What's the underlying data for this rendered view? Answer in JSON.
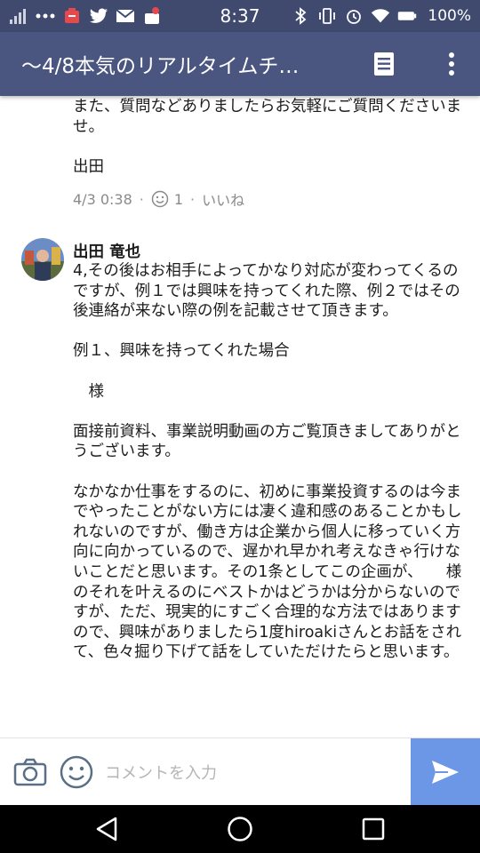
{
  "status_bar": {
    "time": "8:37",
    "battery": "100%",
    "left_icons": [
      "signal-icon",
      "more-dots-icon",
      "app-notification-icon",
      "twitter-icon",
      "mail-icon",
      "store-icon"
    ],
    "right_icons": [
      "bluetooth-icon",
      "vibrate-icon",
      "alarm-icon",
      "wifi-icon",
      "battery-icon"
    ]
  },
  "app_bar": {
    "title": "〜4/8本気のリアルタイムチ…",
    "note_icon": "note-icon",
    "more_icon": "more-vertical-icon"
  },
  "messages": [
    {
      "body": "また、質問などありましたらお気軽にご質問くださいませ。\n\n出田",
      "timestamp": "4/3 0:38",
      "reaction_count": "1",
      "like_label": "いいね"
    },
    {
      "author": "出田 竜也",
      "body": "4,その後はお相手によってかなり対応が変わってくるのですが、例１では興味を持ってくれた際、例２ではその後連絡が来ない際の例を記載させて頂きます。\n\n例１、興味を持ってくれた場合\n\n　様\n\n面接前資料、事業説明動画の方ご覧頂きましてありがとうございます。\n\nなかなか仕事をするのに、初めに事業投資するのは今までやったことがない方には凄く違和感のあることかもしれないのですが、働き方は企業から個人に移っていく方向に向かっているので、遅かれ早かれ考えなきゃ行けないことだと思います。その1条としてこの企画が、　　様のそれを叶えるのにベストかはどうかは分からないのですが、ただ、現実的にすごく合理的な方法ではありますので、興味がありましたら1度hiroakiさんとお話をされて、色々掘り下げて話をしていただけたらと思います。"
    }
  ],
  "comment_bar": {
    "placeholder": "コメントを入力",
    "camera_icon": "camera-icon",
    "emoji_icon": "emoji-icon",
    "send_icon": "send-icon"
  },
  "nav_bar": {
    "back_icon": "back-icon",
    "home_icon": "home-icon",
    "recent_icon": "recent-apps-icon"
  },
  "colors": {
    "status_bar": "#3f4a6e",
    "app_bar": "#4a5580",
    "send_button": "#6b97e6",
    "meta_text": "#8a8a8a"
  }
}
